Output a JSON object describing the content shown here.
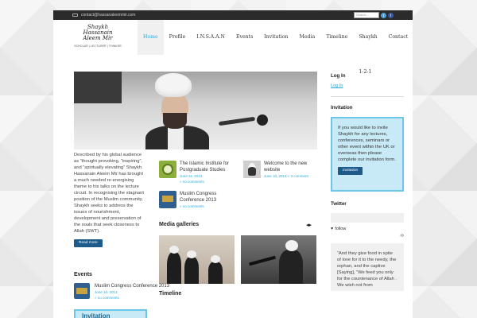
{
  "topbar": {
    "email": "contact@hassanaleemmir.com",
    "search_placeholder": "Search ..."
  },
  "logo": {
    "line1": "Shaykh Hassanain",
    "line2": "Aleem Mir",
    "tagline": "SCHOLAR | LECTURER | THINKER"
  },
  "nav": [
    "Home",
    "Profile",
    "I.N.S.A.A.N",
    "Events",
    "Invitation",
    "Media",
    "Timeline",
    "Shaykh 1-2-1",
    "Contact"
  ],
  "intro": {
    "text": "Described by his global audience as “thought provoking, “inspiring”, and “spiritually elevating” Shaykh Hassanain Aleem Mir has brought a much needed re-energising theme to his talks on the lecture circuit. In recognising the stagnant position of the Muslim community, Shaykh seeks to address the issues of nourishment, development and preservation of the souls that seek closeness to Allah (SWT).",
    "button": "Read more"
  },
  "posts": [
    {
      "title": "The Islamic Institute for Postgraduate Studies",
      "date": "June 11, 2013",
      "comments": "no comments"
    },
    {
      "title": "Welcome to the new website",
      "date": "June 10, 2013",
      "comments": "3 comment"
    },
    {
      "title": "Muslim Congress Conference 2013",
      "date": "June 10, 2013",
      "comments": "no comments"
    }
  ],
  "sections": {
    "media": "Media galleries",
    "timeline": "Timeline",
    "events": "Events",
    "invitation_box": "Invitation"
  },
  "events": [
    {
      "title": "Muslim Congress Conference 2013",
      "date": "June 10, 2013",
      "comments": "no comments"
    }
  ],
  "sidebar": {
    "login_h": "Log In",
    "login_link": "Log In",
    "invitation_h": "Invitation",
    "invitation_text": "If you would like to invite Shaykh for any lectures, conferences, seminars or other event within the UK or overseas then please complete our invitation form.",
    "invitation_button": "Invitation",
    "twitter_h": "Twitter",
    "follow": "follow",
    "quote": "“And they give food in spite of love for it to the needy, the orphan, and the captive [Saying], “We feed you only for the countenance of Allah . We wish not from"
  },
  "colors": {
    "accent": "#29a9d9",
    "button": "#1e5a8a",
    "panel": "#c8eaf7"
  }
}
